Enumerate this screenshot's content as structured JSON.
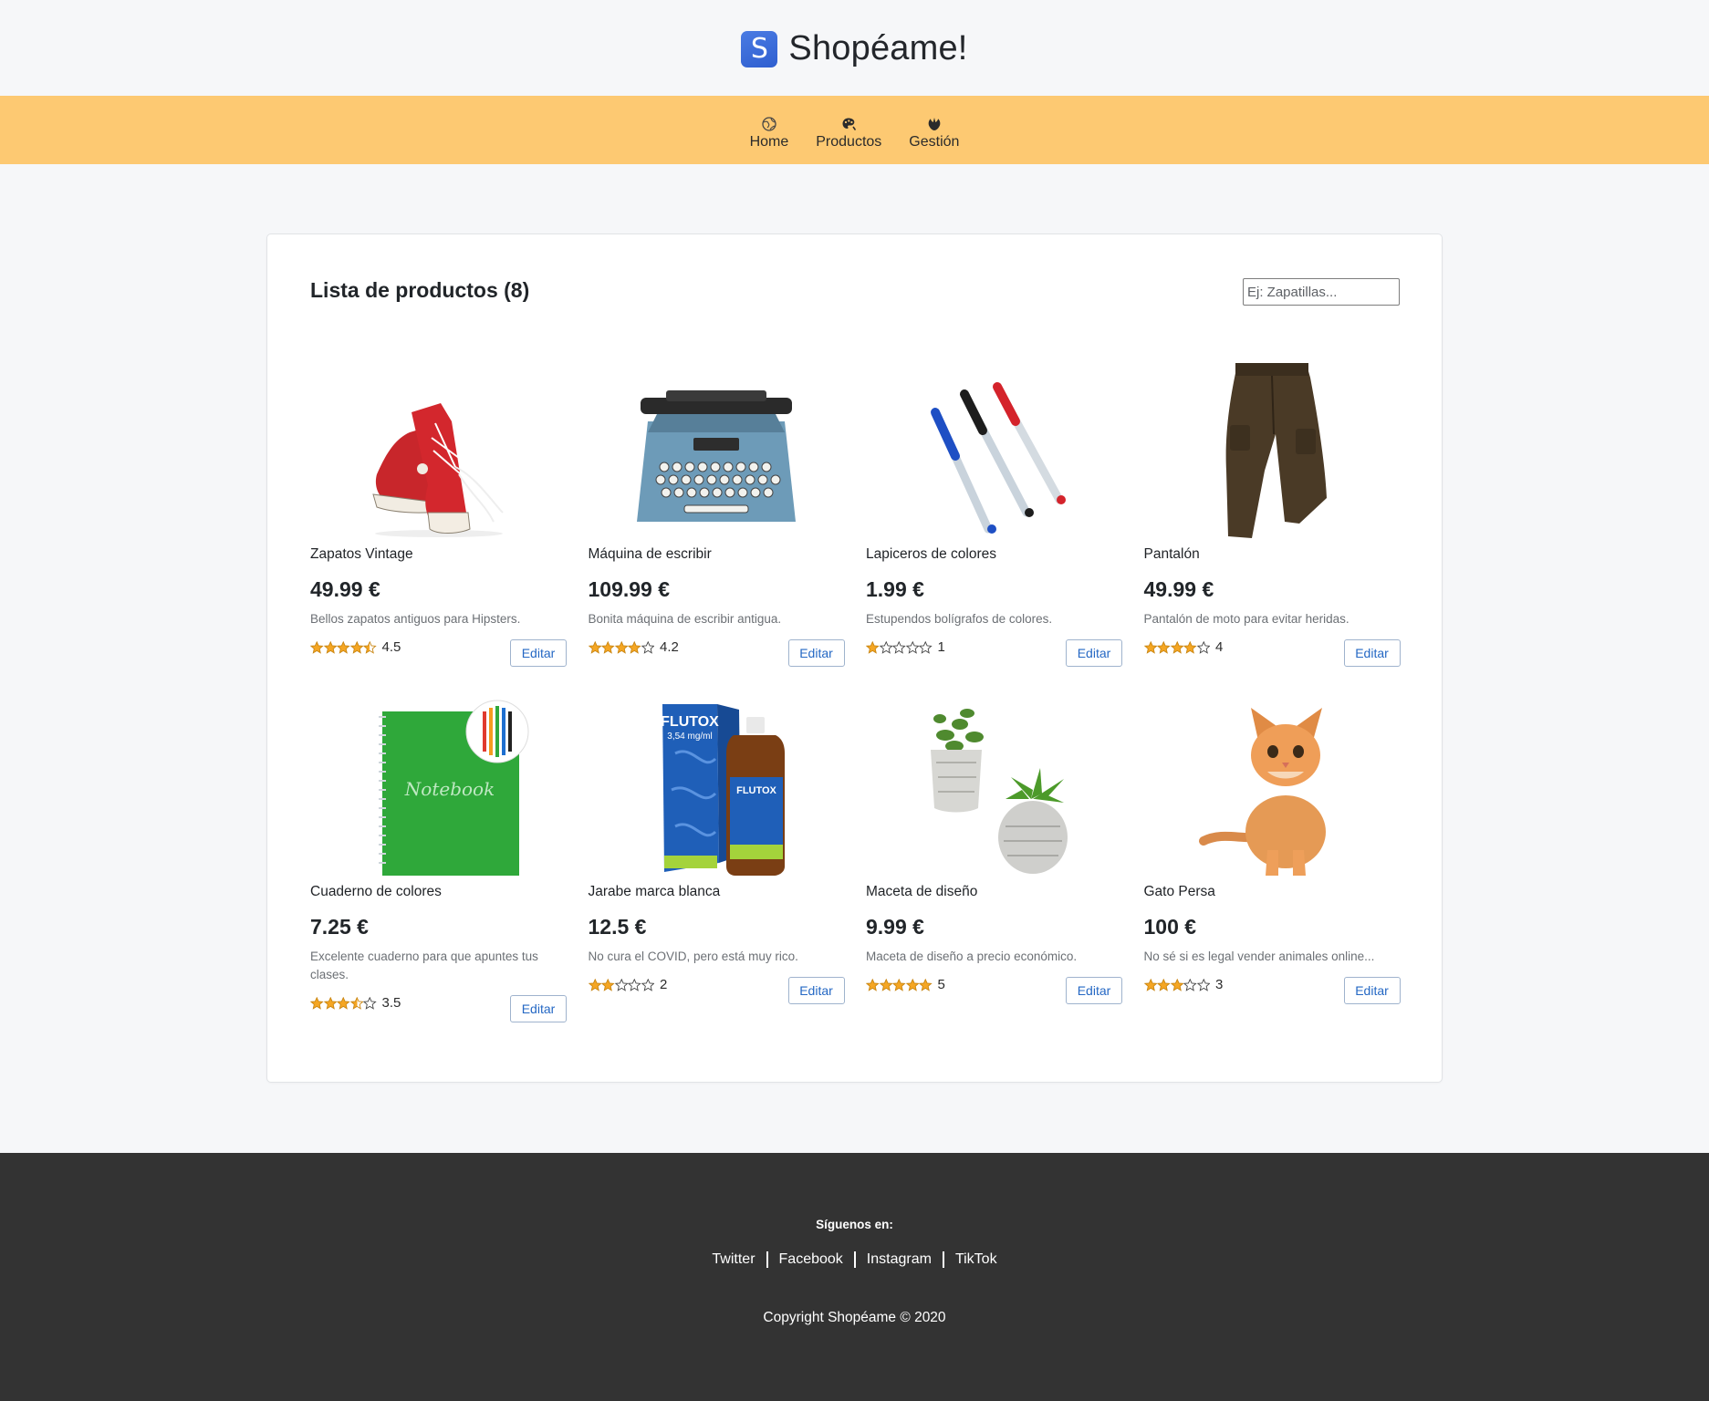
{
  "brand": {
    "logo_letter": "S",
    "name": "Shopéame!",
    "logo_color": "#3a6bdc"
  },
  "nav": {
    "background": "#fdc972",
    "items": [
      {
        "label": "Home",
        "icon": "globe-icon"
      },
      {
        "label": "Productos",
        "icon": "palette-icon"
      },
      {
        "label": "Gestión",
        "icon": "rebel-icon"
      }
    ]
  },
  "list": {
    "title": "Lista de productos (8)",
    "search_placeholder": "Ej: Zapatillas...",
    "edit_label": "Editar"
  },
  "products": [
    {
      "name": "Zapatos Vintage",
      "price": "49.99 €",
      "description": "Bellos zapatos antiguos para Hipsters.",
      "rating": 4.5,
      "rating_text": "4.5",
      "image": "sneakers"
    },
    {
      "name": "Máquina de escribir",
      "price": "109.99 €",
      "description": "Bonita máquina de escribir antigua.",
      "rating": 4.2,
      "rating_text": "4.2",
      "image": "typewriter"
    },
    {
      "name": "Lapiceros de colores",
      "price": "1.99 €",
      "description": "Estupendos bolígrafos de colores.",
      "rating": 1,
      "rating_text": "1",
      "image": "pens"
    },
    {
      "name": "Pantalón",
      "price": "49.99 €",
      "description": "Pantalón de moto para evitar heridas.",
      "rating": 4,
      "rating_text": "4",
      "image": "trousers"
    },
    {
      "name": "Cuaderno de colores",
      "price": "7.25 €",
      "description": "Excelente cuaderno para que apuntes tus clases.",
      "rating": 3.5,
      "rating_text": "3.5",
      "image": "notebook"
    },
    {
      "name": "Jarabe marca blanca",
      "price": "12.5 €",
      "description": "No cura el COVID, pero está muy rico.",
      "rating": 2,
      "rating_text": "2",
      "image": "syrup"
    },
    {
      "name": "Maceta de diseño",
      "price": "9.99 €",
      "description": "Maceta de diseño a precio económico.",
      "rating": 5,
      "rating_text": "5",
      "image": "plants"
    },
    {
      "name": "Gato Persa",
      "price": "100 €",
      "description": "No sé si es legal vender animales online...",
      "rating": 3,
      "rating_text": "3",
      "image": "kitten"
    }
  ],
  "image_texts": {
    "notebook": "Notebook",
    "syrup_brand": "FLUTOX",
    "syrup_dose": "3,54 mg/ml"
  },
  "footer": {
    "follow": "Síguenos en:",
    "socials": [
      "Twitter",
      "Facebook",
      "Instagram",
      "TikTok"
    ],
    "copyright": "Copyright Shopéame © 2020"
  },
  "colors": {
    "star": "#f5a623",
    "edit_button_text": "#2568c4",
    "footer_bg": "#333333"
  }
}
